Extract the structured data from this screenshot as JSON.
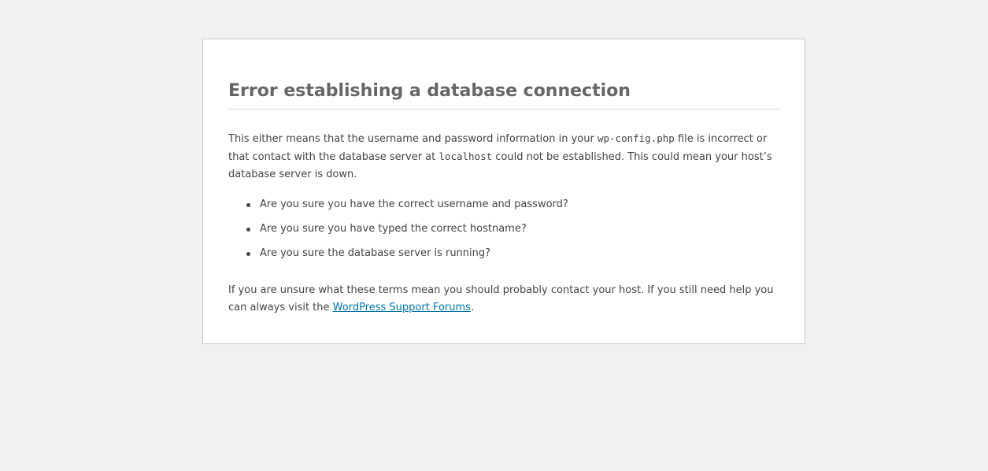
{
  "colors": {
    "page_background": "#f1f1f1",
    "panel_background": "#ffffff",
    "heading": "#666666",
    "text": "#444444",
    "link": "#0073aa"
  },
  "error": {
    "title": "Error establishing a database connection",
    "intro": {
      "part1": "This either means that the username and password information in your ",
      "config_file": "wp-config.php",
      "part2": " file is incorrect or that contact with the database server at ",
      "host": "localhost",
      "part3": " could not be established. This could mean your host’s database server is down."
    },
    "checklist": [
      "Are you sure you have the correct username and password?",
      "Are you sure you have typed the correct hostname?",
      "Are you sure the database server is running?"
    ],
    "help": {
      "text": "If you are unsure what these terms mean you should probably contact your host. If you still need help you can always visit the ",
      "link_text": "WordPress Support Forums",
      "end": "."
    }
  }
}
